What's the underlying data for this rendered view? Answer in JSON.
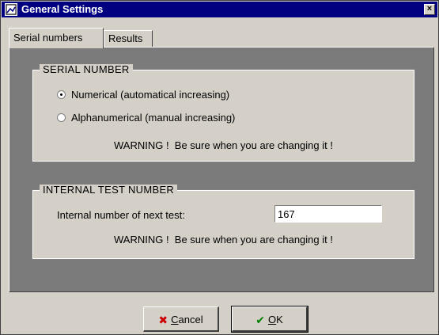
{
  "window": {
    "title": "General Settings",
    "close_symbol": "×"
  },
  "tabs": [
    {
      "label": "Serial numbers",
      "active": true
    },
    {
      "label": "Results",
      "active": false
    }
  ],
  "serial_group": {
    "legend": "SERIAL NUMBER",
    "options": [
      {
        "label": "Numerical (automatical increasing)",
        "selected": true
      },
      {
        "label": "Alphanumerical (manual increasing)",
        "selected": false
      }
    ],
    "warning": "WARNING !  Be sure when you are changing it !"
  },
  "internal_group": {
    "legend": "INTERNAL TEST NUMBER",
    "field_label": "Internal number of next test:",
    "field_value": "167",
    "warning": "WARNING !  Be sure when you are changing it !"
  },
  "buttons": {
    "cancel": {
      "icon": "x-icon",
      "icon_glyph": "✖",
      "accel": "C",
      "rest": "ancel"
    },
    "ok": {
      "icon": "check-icon",
      "icon_glyph": "✔",
      "accel": "O",
      "rest": "K"
    }
  },
  "colors": {
    "title_bar": "#000080",
    "dialog_face": "#d4d0c8",
    "panel_background": "#7b7b7b",
    "cancel_icon": "#cc0000",
    "ok_icon": "#008000"
  }
}
